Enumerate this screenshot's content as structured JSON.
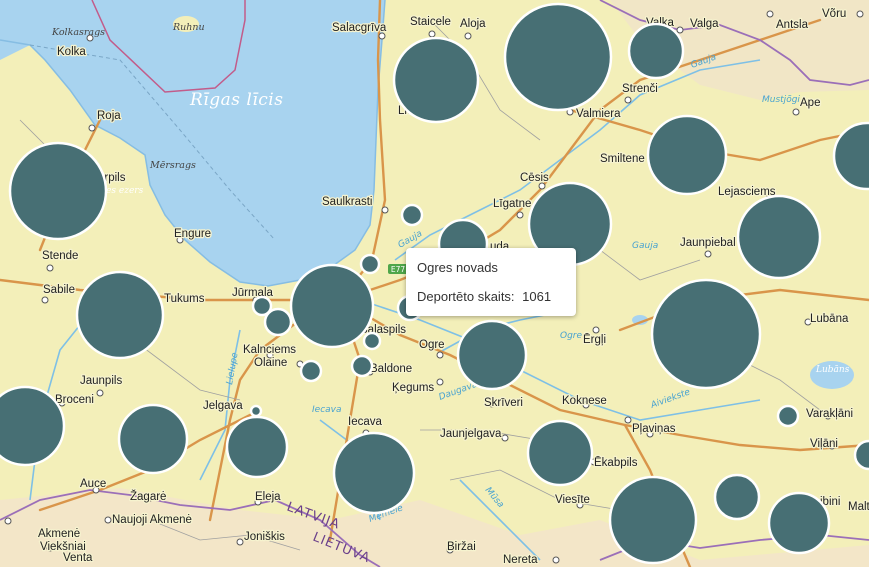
{
  "map": {
    "water_labels": {
      "gulf": "Rīgas līcis",
      "island": "Ruhnu",
      "lake": "Lubāns",
      "ezers": "ures ezers"
    },
    "capes": {
      "kolkasrags": "Kolkasrags",
      "mersrags": "Mērsrags"
    },
    "rivers": {
      "gauja1": "Gauja",
      "gauja2": "Gauja",
      "gauja3": "Gauja",
      "ogre": "Ogre",
      "lielupe": "Lielupe",
      "iecava": "Iecava",
      "daugava": "Daugava",
      "aiviekste": "Aiviekste",
      "memele": "Mēmele",
      "musa": "Mūsa",
      "venta": "Venta",
      "mustjogi": "Mustjõgi"
    },
    "borders": {
      "latvija": "LATVIJA",
      "lietuva": "LIETUVA"
    },
    "road_badge": "E77",
    "places": {
      "salacgriva": "Salacgrīva",
      "staicele": "Staicele",
      "aloja": "Aloja",
      "valka": "Valka",
      "valga": "Valga",
      "antsla": "Antsla",
      "voru": "Võru",
      "kolka": "Kolka",
      "roja": "Roja",
      "strenci": "Strenči",
      "valmiera": "Valmiera",
      "ape": "Ape",
      "smiltene": "Smiltene",
      "cesis": "Cēsis",
      "saulkrasti": "Saulkrasti",
      "ligatne": "Līgatne",
      "lejasciems": "Lejasciems",
      "engure": "Engure",
      "stende": "Stende",
      "sabile": "Sabile",
      "jaunpiebalga": "Jaunpiebal",
      "jurmala": "Jūrmala",
      "tukums": "Tukums",
      "salaspils": "Salaspils",
      "kalnciems": "Kalnciems",
      "olaine": "Olaine",
      "ogre": "Ogre",
      "ergli": "Ērgļi",
      "lubana": "Lubāna",
      "baldone": "Baldone",
      "kegums": "Ķegums",
      "jaunpils": "Jaunpils",
      "broceni": "Broceni",
      "skriveri": "Skrīveri",
      "koknese": "Koknese",
      "varaklani": "Varakļāni",
      "jelgava": "Jelgava",
      "iecava": "Iecava",
      "plavinas": "Pļaviņas",
      "jaunjelgava": "Jaunjelgava",
      "vilani": "Viļāni",
      "auce": "Auce",
      "zagare": "Žagarė",
      "eleja": "Eleja",
      "jekabpils": "Ēkabpils",
      "viesite": "Viesīte",
      "akmene": "Akmenė",
      "naujoji": "Naujoji Akmenė",
      "ventspils_v": "Venta",
      "vieksniai": "Viekšniai",
      "joniskis": "Joniškis",
      "birzai": "Biržai",
      "nereta": "Nereta",
      "ribini": "ibini",
      "malta": "Malt",
      "arpils": "ārpils",
      "lielv": "Lie",
      "uda": "uda"
    }
  },
  "chart_data": {
    "type": "bubble-map",
    "metric": "Deportēto skaits",
    "highlighted": {
      "region": "Ogres novads",
      "value": 1061
    }
  },
  "tooltip": {
    "title": "Ogres novads",
    "label": "Deportēto skaits:",
    "value": "1061"
  },
  "colors": {
    "land": "#f3efb9",
    "water": "#a8d3ef",
    "bubble": "#476f74",
    "road": "#d9954a",
    "border": "#9b6fb8"
  }
}
